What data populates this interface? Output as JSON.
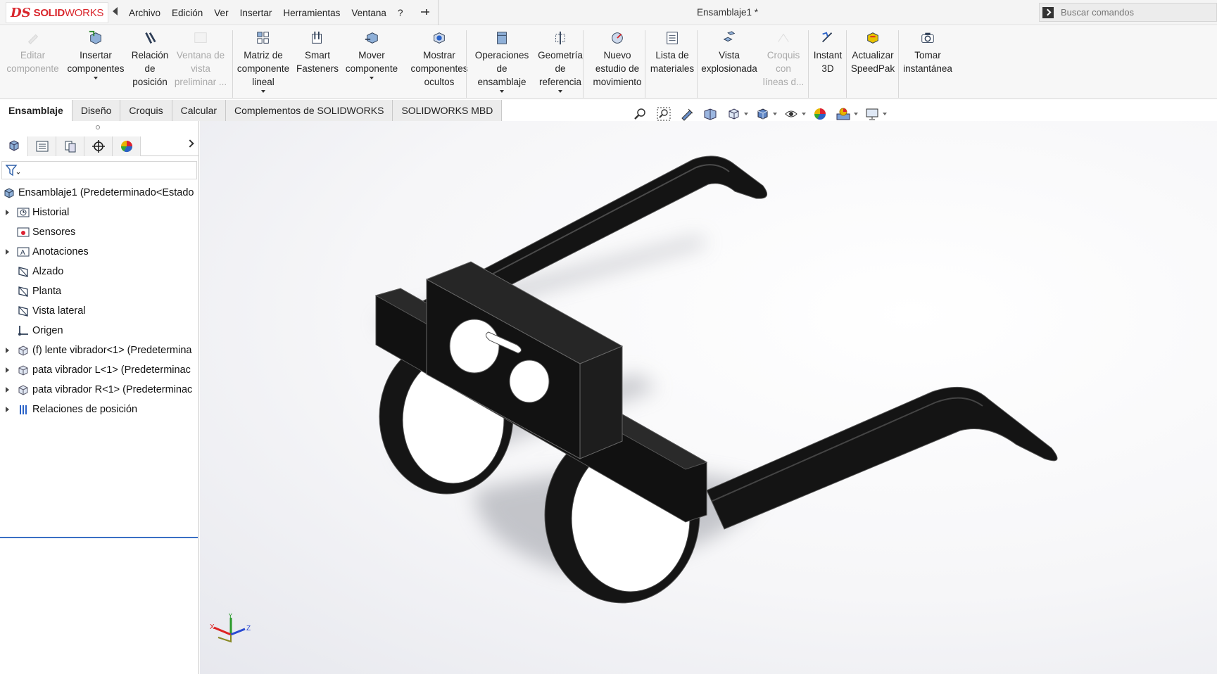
{
  "app": {
    "logo_ds": "DS",
    "logo_brand_bold": "SOLID",
    "logo_brand_rest": "WORKS",
    "document_title": "Ensamblaje1 *"
  },
  "menu": [
    "Archivo",
    "Edición",
    "Ver",
    "Insertar",
    "Herramientas",
    "Ventana",
    "?"
  ],
  "search": {
    "placeholder": "Buscar comandos"
  },
  "ribbon": [
    {
      "label": "Editar\ncomponente",
      "disabled": true
    },
    {
      "label": "Insertar\ncomponentes",
      "dropdown": true
    },
    {
      "label": "Relación\nde\nposición"
    },
    {
      "label": "Ventana de\nvista\npreliminar ...",
      "disabled": true
    },
    {
      "label": "Matriz de\ncomponente\nlineal",
      "dropdown": true
    },
    {
      "label": "Smart\nFasteners"
    },
    {
      "label": "Mover\ncomponente",
      "dropdown": true
    },
    {
      "label": "Mostrar\ncomponentes\nocultos"
    },
    {
      "label": "Operaciones\nde\nensamblaje",
      "dropdown": true
    },
    {
      "label": "Geometría\nde\nreferencia",
      "dropdown": true
    },
    {
      "label": "Nuevo\nestudio de\nmovimiento"
    },
    {
      "label": "Lista de\nmateriales"
    },
    {
      "label": "Vista\nexplosionada"
    },
    {
      "label": "Croquis\ncon\nlíneas d...",
      "disabled": true
    },
    {
      "label": "Instant\n3D"
    },
    {
      "label": "Actualizar\nSpeedPak"
    },
    {
      "label": "Tomar\ninstantánea"
    }
  ],
  "tabs": [
    "Ensamblaje",
    "Diseño",
    "Croquis",
    "Calcular",
    "Complementos de SOLIDWORKS",
    "SOLIDWORKS MBD"
  ],
  "tree": [
    {
      "label": "Ensamblaje1  (Predeterminado<Estado",
      "expander": false,
      "icon": "assembly-icon"
    },
    {
      "label": "Historial",
      "expander": true,
      "icon": "history-folder-icon"
    },
    {
      "label": "Sensores",
      "expander": false,
      "icon": "sensor-folder-icon"
    },
    {
      "label": "Anotaciones",
      "expander": true,
      "icon": "annotations-folder-icon"
    },
    {
      "label": "Alzado",
      "expander": false,
      "icon": "plane-icon"
    },
    {
      "label": "Planta",
      "expander": false,
      "icon": "plane-icon"
    },
    {
      "label": "Vista lateral",
      "expander": false,
      "icon": "plane-icon"
    },
    {
      "label": "Origen",
      "expander": false,
      "icon": "origin-icon"
    },
    {
      "label": "(f) lente vibrador<1> (Predetermina",
      "expander": true,
      "icon": "part-icon"
    },
    {
      "label": "pata vibrador L<1> (Predeterminac",
      "expander": true,
      "icon": "part-icon"
    },
    {
      "label": "pata vibrador R<1> (Predeterminac",
      "expander": true,
      "icon": "part-icon"
    },
    {
      "label": "Relaciones de posición",
      "expander": true,
      "icon": "mates-icon"
    }
  ],
  "triad": {
    "x": "X",
    "y": "Y",
    "z": "Z"
  },
  "colors": {
    "brand": "#d9262c",
    "model": "#1b1b1b",
    "rollback": "#3a6fc4"
  }
}
